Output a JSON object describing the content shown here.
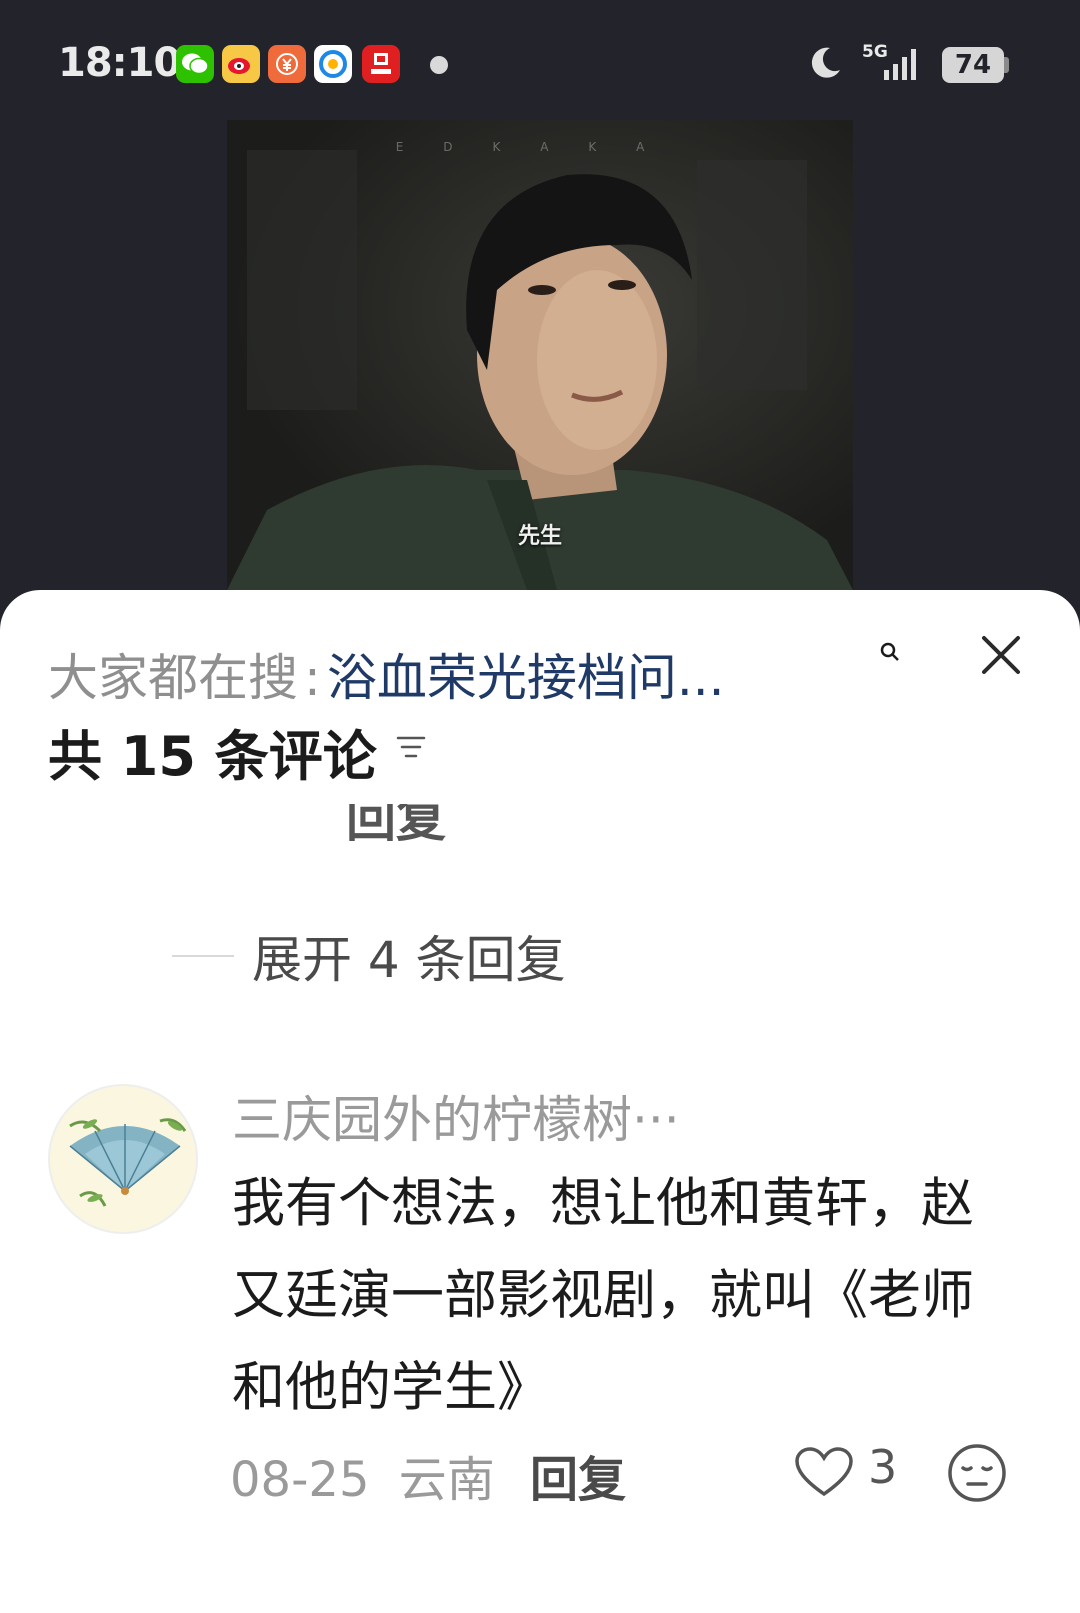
{
  "status_bar": {
    "time": "18:10",
    "notification_icons": [
      "wechat-icon",
      "weibo-icon",
      "payment-icon",
      "qq-browser-icon",
      "securities-app-icon"
    ],
    "network": "5G",
    "battery": "74"
  },
  "video": {
    "watermark": "EDKAKA",
    "caption": "先生"
  },
  "comments_sheet": {
    "trending_prefix": "大家都在搜",
    "trending_colon": ":",
    "trending_topic": "浴血荣光接档问...",
    "count_label": "共 15 条评论",
    "cut_reply_label": "回复",
    "expand_label": "展开 4 条回复",
    "comment": {
      "username": "三庆园外的柠檬树···",
      "text": "我有个想法，想让他和黄轩，赵又廷演一部影视剧，就叫《老师和他的学生》",
      "date": "08-25",
      "location": "云南",
      "reply_label": "回复",
      "likes": "3"
    }
  },
  "colors": {
    "background": "#23242b",
    "sheet": "#ffffff",
    "topic": "#1f3a66",
    "muted": "#9a9a9a"
  }
}
